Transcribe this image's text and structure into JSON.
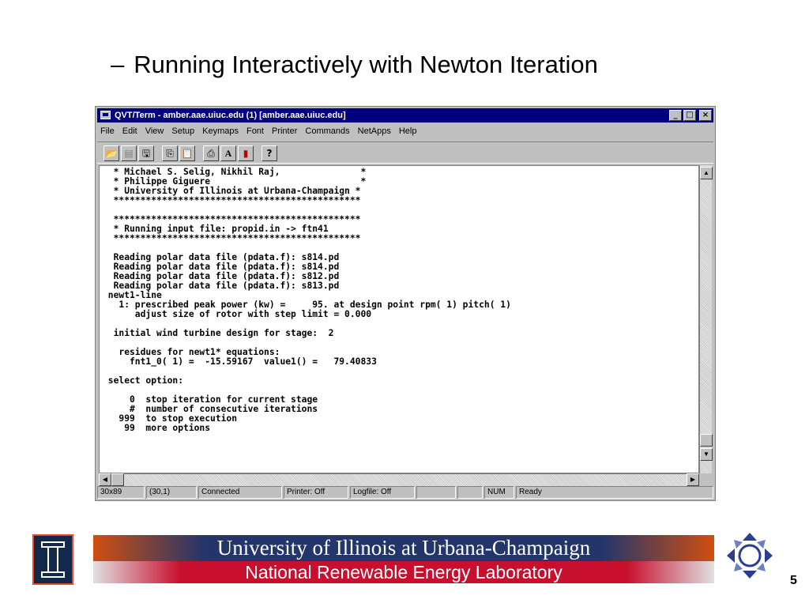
{
  "slide": {
    "dash": "–",
    "title": "Running Interactively with Newton Iteration",
    "page_number": "5"
  },
  "window": {
    "title": "QVT/Term - amber.aae.uiuc.edu (1) [amber.aae.uiuc.edu]",
    "controls": {
      "minimize": "_",
      "maximize": "□",
      "close": "×"
    }
  },
  "menu": {
    "items": [
      "File",
      "Edit",
      "View",
      "Setup",
      "Keymaps",
      "Font",
      "Printer",
      "Commands",
      "NetApps",
      "Help"
    ]
  },
  "toolbar": {
    "buttons": [
      {
        "icon": "open-folder-icon",
        "glyph": "📂"
      },
      {
        "icon": "disabled-tool-icon",
        "glyph": "▤"
      },
      {
        "icon": "save-icon",
        "glyph": "🖫"
      },
      {
        "icon": "copy-icon",
        "glyph": "⎘"
      },
      {
        "icon": "paste-icon",
        "glyph": "📋"
      },
      {
        "icon": "print-icon",
        "glyph": "⎙"
      },
      {
        "icon": "font-icon",
        "glyph": "A"
      },
      {
        "icon": "color-icon",
        "glyph": "▮"
      },
      {
        "icon": "help-icon",
        "glyph": "?"
      }
    ]
  },
  "terminal": {
    "lines": [
      "  * Michael S. Selig, Nikhil Raj,               *",
      "  * Philippe Giguere                            *",
      "  * University of Illinois at Urbana-Champaign *",
      "  **********************************************",
      "",
      "  **********************************************",
      "  * Running input file: propid.in -> ftn41",
      "  **********************************************",
      "",
      "  Reading polar data file (pdata.f): s814.pd",
      "  Reading polar data file (pdata.f): s814.pd",
      "  Reading polar data file (pdata.f): s812.pd",
      "  Reading polar data file (pdata.f): s813.pd",
      " newt1-line",
      "   1: prescribed peak power (kw) =     95. at design point rpm( 1) pitch( 1)",
      "      adjust size of rotor with step limit = 0.000",
      "",
      "  initial wind turbine design for stage:  2",
      "",
      "   residues for newt1* equations:",
      "     fnt1_0( 1) =  -15.59167  value1() =   79.40833",
      "",
      " select option:",
      "",
      "     0  stop iteration for current stage",
      "     #  number of consecutive iterations",
      "   999  to stop execution",
      "    99  more options"
    ]
  },
  "status": {
    "size": "30x89",
    "cursor": "(30,1)",
    "connection": "Connected",
    "printer": "Printer: Off",
    "logfile": "Logfile: Off",
    "blank1": "",
    "blank2": "",
    "num": "NUM",
    "ready": "Ready"
  },
  "footer": {
    "university": "University of Illinois at Urbana-Champaign",
    "lab": "National Renewable Energy Laboratory"
  },
  "colors": {
    "title_bar": "#000080",
    "illinois_blue": "#13294b",
    "illinois_orange": "#e84a27",
    "nrel_red": "#c8102e"
  }
}
